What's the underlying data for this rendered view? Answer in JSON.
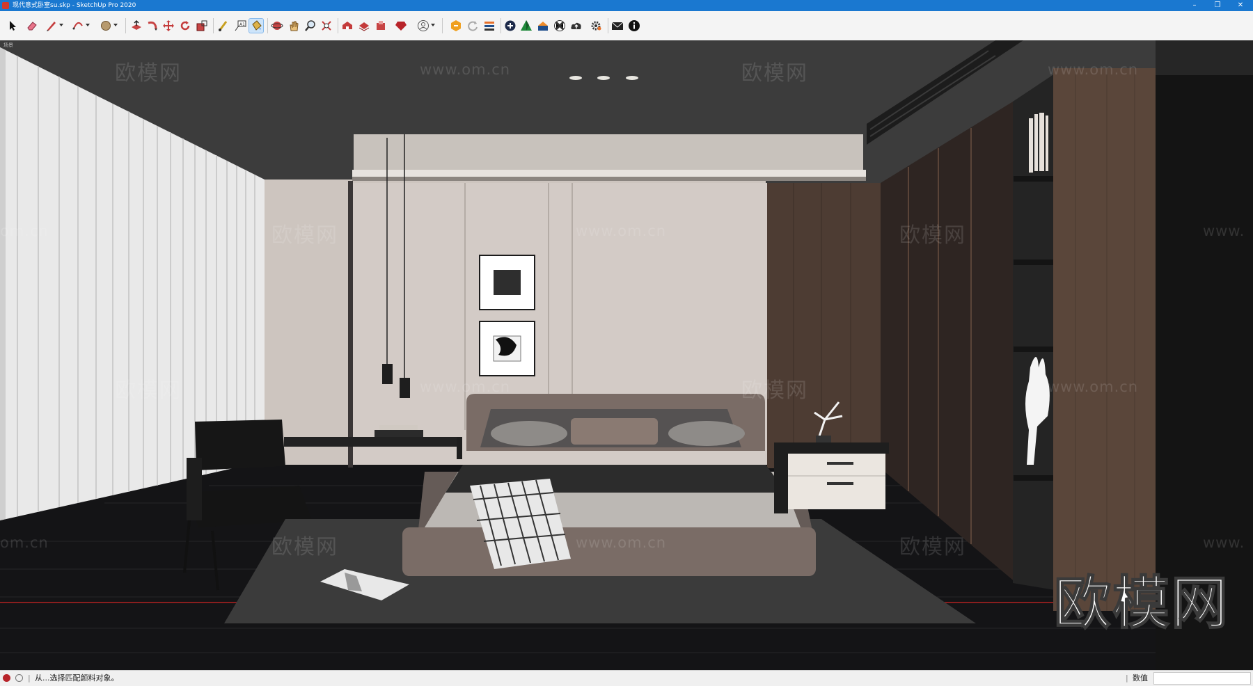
{
  "window": {
    "title": "现代意式卧室su.skp - SketchUp Pro 2020",
    "minimize_glyph": "–",
    "restore_glyph": "❐",
    "close_glyph": "✕"
  },
  "toolbar": {
    "tools": [
      {
        "name": "select-tool",
        "icon": "arrow-cursor-icon"
      },
      {
        "name": "eraser-tool",
        "icon": "eraser-icon"
      },
      {
        "name": "line-tool",
        "icon": "pencil-icon"
      },
      {
        "name": "arc-tool",
        "icon": "arc-icon"
      },
      {
        "name": "shape-tool",
        "icon": "circle-icon"
      },
      {
        "name": "push-pull-tool",
        "icon": "push-pull-icon"
      },
      {
        "name": "follow-me-tool",
        "icon": "follow-me-icon"
      },
      {
        "name": "move-tool",
        "icon": "move-icon"
      },
      {
        "name": "rotate-tool",
        "icon": "rotate-icon"
      },
      {
        "name": "scale-tool",
        "icon": "scale-icon"
      },
      {
        "name": "tape-measure-tool",
        "icon": "tape-measure-icon"
      },
      {
        "name": "text-tool",
        "icon": "text-label-icon"
      },
      {
        "name": "paint-bucket-tool",
        "icon": "paint-bucket-icon"
      },
      {
        "name": "orbit-tool",
        "icon": "orbit-icon"
      },
      {
        "name": "pan-tool",
        "icon": "pan-hand-icon"
      },
      {
        "name": "zoom-tool",
        "icon": "zoom-icon"
      },
      {
        "name": "zoom-extents-tool",
        "icon": "zoom-extents-icon"
      },
      {
        "name": "3d-warehouse-tool",
        "icon": "warehouse-icon"
      },
      {
        "name": "share-model-tool",
        "icon": "share-model-icon"
      },
      {
        "name": "extension-warehouse-tool",
        "icon": "extension-warehouse-icon"
      },
      {
        "name": "ruby-console-tool",
        "icon": "ruby-icon"
      },
      {
        "name": "account-tool",
        "icon": "user-icon"
      },
      {
        "name": "plugin-tool-1",
        "icon": "plugin-orange-icon"
      },
      {
        "name": "refresh-tool",
        "icon": "refresh-icon"
      },
      {
        "name": "layers-tool",
        "icon": "layers-icon"
      },
      {
        "name": "add-location-tool",
        "icon": "add-circle-icon"
      },
      {
        "name": "terrain-tool",
        "icon": "terrain-icon"
      },
      {
        "name": "photo-texture-tool",
        "icon": "photo-texture-icon"
      },
      {
        "name": "sandbox-tool",
        "icon": "checker-ball-icon"
      },
      {
        "name": "cloud-upload-tool",
        "icon": "cloud-upload-icon"
      },
      {
        "name": "settings-tool",
        "icon": "gear-icon"
      },
      {
        "name": "mail-tool",
        "icon": "mail-icon"
      },
      {
        "name": "info-tool",
        "icon": "info-icon"
      }
    ]
  },
  "viewport": {
    "scene_label": "场景",
    "watermark_text": "欧模网",
    "watermark_url": "www.om.cn",
    "watermark_url_cut": "om.cn",
    "watermark_url_cut_right": "www.",
    "brand_logo": "欧模网"
  },
  "statusbar": {
    "message": "从...选择匹配颜料对象。",
    "measurements_label": "数值",
    "measurements_value": ""
  },
  "colors": {
    "titlebar": "#1a78d0",
    "ceiling": "#3c3c3c",
    "back_wall": "#cdc5bf",
    "wood": "#4a3a31",
    "floor": "#141416",
    "rug": "#3b3b3b",
    "bed": "#7a6c66"
  }
}
